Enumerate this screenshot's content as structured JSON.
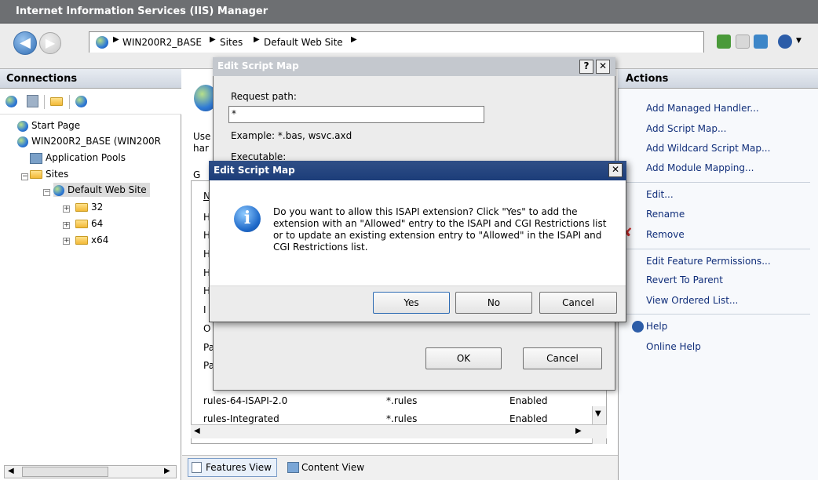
{
  "window": {
    "title": "Internet Information Services (IIS) Manager"
  },
  "breadcrumb": [
    "WIN200R2_BASE",
    "Sites",
    "Default Web Site"
  ],
  "connections": {
    "header": "Connections",
    "tree": [
      "Start Page",
      "WIN200R2_BASE (WIN200R",
      "Application Pools",
      "Sites",
      "Default Web Site",
      "32",
      "64",
      "x64"
    ]
  },
  "center": {
    "intro_line1": "Use",
    "intro_line2": "har",
    "group_letter": "G",
    "col_letter": "N",
    "rows": [
      {
        "name": "H"
      },
      {
        "name": "H"
      },
      {
        "name": "H"
      },
      {
        "name": "H"
      },
      {
        "name": "H"
      },
      {
        "name": "I"
      },
      {
        "name": "O"
      },
      {
        "name": "Pa"
      },
      {
        "name": "Pa"
      },
      {
        "name": "rules-64-ISAPI-2.0",
        "path": "*.rules",
        "state": "Enabled"
      },
      {
        "name": "rules-Integrated",
        "path": "*.rules",
        "state": "Enabled"
      }
    ],
    "views": {
      "features": "Features View",
      "content": "Content View"
    }
  },
  "actions": {
    "header": "Actions",
    "items": [
      "Add Managed Handler...",
      "Add Script Map...",
      "Add Wildcard Script Map...",
      "Add Module Mapping...",
      "Edit...",
      "Rename",
      "Remove",
      "Edit Feature Permissions...",
      "Revert To Parent",
      "View Ordered List...",
      "Help",
      "Online Help"
    ]
  },
  "edit_dialog": {
    "title": "Edit Script Map",
    "request_path_label": "Request path:",
    "request_path_value": "*",
    "example": "Example: *.bas, wsvc.axd",
    "executable_label": "Executable:",
    "ok": "OK",
    "cancel": "Cancel"
  },
  "confirm_dialog": {
    "title": "Edit Script Map",
    "message": "Do you want to allow this ISAPI extension? Click \"Yes\" to add the extension with an \"Allowed\" entry to the ISAPI and CGI Restrictions list or to update an existing extension entry to \"Allowed\" in the ISAPI and CGI Restrictions list.",
    "yes": "Yes",
    "no": "No",
    "cancel": "Cancel"
  },
  "colors": {
    "titlebar": "#6d6f72",
    "dialog_title": "#1c3d79",
    "link": "#102e7a"
  }
}
